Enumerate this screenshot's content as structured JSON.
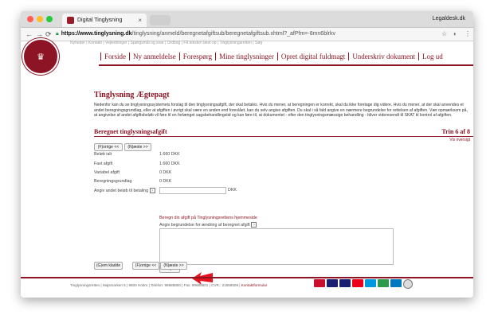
{
  "browser": {
    "tab_title": "Digital Tinglysning",
    "profile_name": "Legaldesk.dk",
    "url_host": "https://www.tinglysning.dk",
    "url_path": "/tinglysning/anmeld/beregnetafgiftsub/beregnetafgiftsub.xhtml?_afPfm=-8mn6blrkv"
  },
  "site": {
    "top_links": "Nyheder   |   Kontakt   |   Vejledninger   |   Spørgsmål og svar   |   Ordbog   |   Få teksten læst op   |   Tinglysningsretten   |   Søg",
    "nav": [
      "Forside",
      "Ny anmeldelse",
      "Forespørg",
      "Mine tinglysninger",
      "Opret digital fuldmagt",
      "Underskriv dokument",
      "Log ud"
    ]
  },
  "main": {
    "title": "Tinglysning Ægtepagt",
    "intro": "Nedenfor kan du se tinglysningssystemets forslag til den tinglysningsafgift, der skal betales. Hvis du mener, at beregningen er korrekt, skal du ikke foretage dig videre. Hvis du mener, at der skal anvendes et andet beregningsgrundlag, eller at afgiften i øvrigt skal være en anden end foreslået, kan du selv angive afgiften. Du skal i så fald angive en nærmere begrundelse for rettelsen af afgiften. Vær opmærksom på, at angivelse af andet afgiftsbeløb vil føre til en forlænget sagsbehandlingstid og kan føre til, at dokumentet - efter den tinglysningsmæssige behandling - bliver videresendt til SKAT til kontrol af afgiften.",
    "section_title": "Beregnet tinglysningsafgift",
    "step": "Trin 6 af 8",
    "overview_link": "Vis oversigt",
    "prev_button": "(F)orrige <<",
    "next_button": "(N)æste >>",
    "rows": [
      {
        "label": "Beløb ialt",
        "value": "1.660  DKK"
      },
      {
        "label": "Fast afgift",
        "value": "1.660  DKK"
      },
      {
        "label": "Variabel afgift",
        "value": "0  DKK"
      },
      {
        "label": "Beregningsgrundlag",
        "value": "0  DKK"
      }
    ],
    "other_amount_label": "Angiv andet beløb til betaling",
    "other_amount_value": "",
    "currency": "DKK",
    "calc_link": "Beregn din afgift på Tinglysningsrettens hjemmeside",
    "reason_label": "Angiv begrundelse for ændring af beregnet afgift",
    "reason_value": "",
    "add_button": "Tilføj/ret",
    "save_draft_button": "(G)em kladde",
    "prev_button_bottom": "(F)orrige <<",
    "next_button_bottom": "(N)æste >>"
  },
  "footer": {
    "text": "Tinglysningsretten   |   Majsmarken 5   |   9500 Hobro   |   Telefon: 99685800   |   Fax: 99685801   |   CVR.: 21659509   |",
    "contact": "Kontaktformular"
  },
  "colors": {
    "brand": "#8c1424",
    "arrow": "#e4141c"
  },
  "icons": [
    "back-arrow-icon",
    "forward-arrow-icon",
    "reload-icon",
    "lock-icon",
    "star-icon",
    "extension-icon",
    "menu-icon",
    "help-icon",
    "arrow-pointer-icon",
    "dankort-icon",
    "visa-icon",
    "visa-electron-icon",
    "mastercard-icon",
    "maestro-icon",
    "jcb-icon",
    "diners-icon",
    "cvr-icon"
  ]
}
